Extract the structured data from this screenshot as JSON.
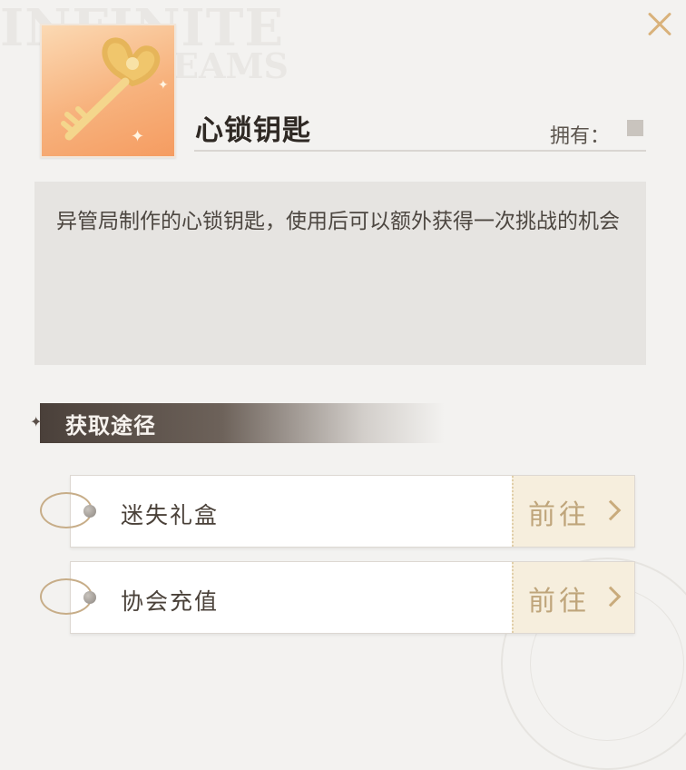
{
  "watermark": {
    "line1": "INFINITE",
    "line2": "EAMS"
  },
  "item": {
    "name": "心锁钥匙",
    "owned_label": "拥有：",
    "description": "异管局制作的心锁钥匙，使用后可以额外获得一次挑战的机会"
  },
  "icons": {
    "close": "close-icon",
    "item": "golden-heart-key-icon",
    "forward": "chevron-right-icon"
  },
  "section": {
    "title": "获取途径"
  },
  "routes": [
    {
      "label": "迷失礼盒",
      "button": "前往"
    },
    {
      "label": "协会充值",
      "button": "前往"
    }
  ],
  "colors": {
    "accent": "#d9b27b",
    "button_bg": "#f6eedd",
    "header_bg": "#4a403a"
  }
}
